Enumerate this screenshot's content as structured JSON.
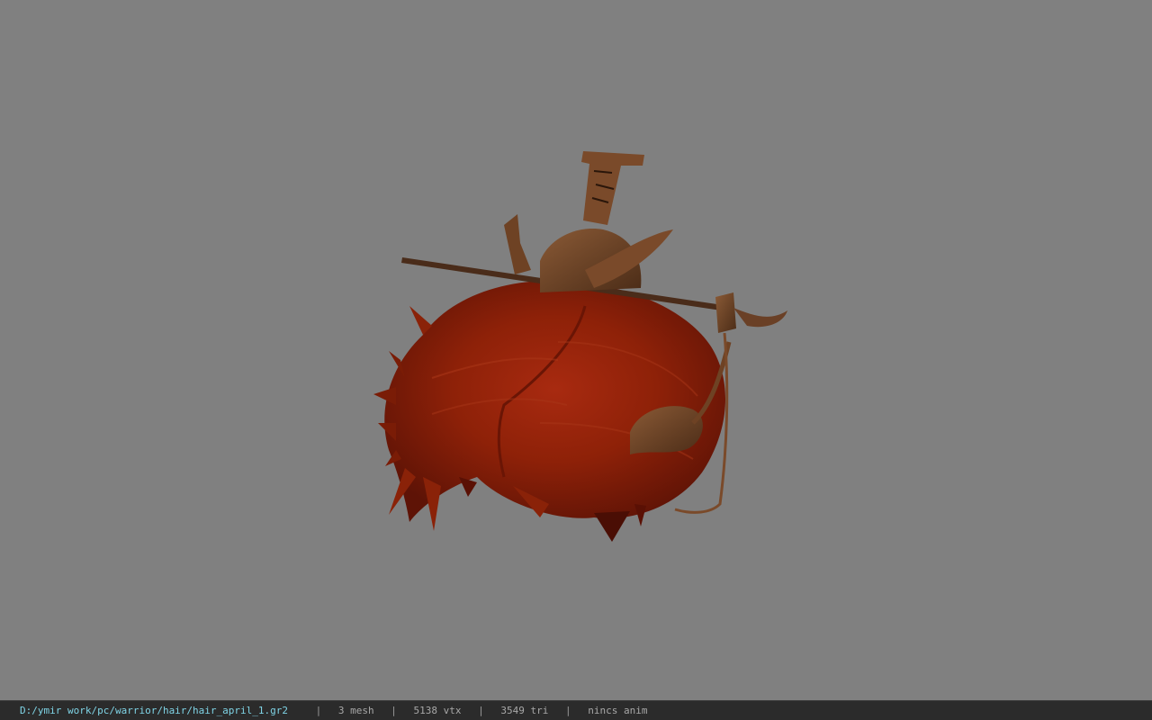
{
  "viewer": {
    "background_color": "#808080",
    "model_name": "hair-with-ornamental-hairpin"
  },
  "statusbar": {
    "file_path": "D:/ymir work/pc/warrior/hair/hair_april_1.gr2",
    "separator": "|",
    "mesh_count": "3 mesh",
    "vertex_count": "5138 vtx",
    "triangle_count": "3549 tri",
    "anim_status": "nincs anim",
    "path_color": "#7fd4e6",
    "bar_color": "#2b2b2b"
  }
}
